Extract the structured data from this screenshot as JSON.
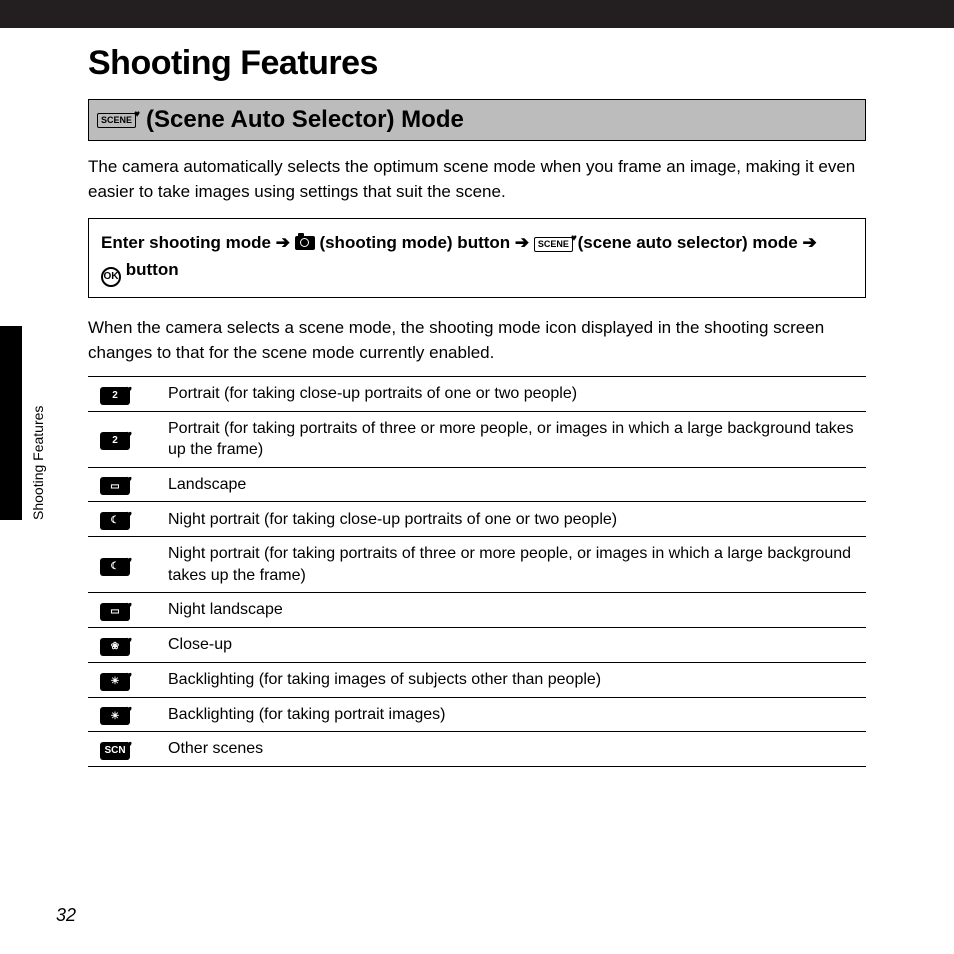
{
  "chapterTitle": "Shooting Features",
  "sideLabel": "Shooting Features",
  "pageNumber": "32",
  "sectionHeading": "(Scene Auto Selector) Mode",
  "introText": "The camera automatically selects the optimum scene mode when you frame an image, making it even easier to take images using settings that suit the scene.",
  "navigation": {
    "p1": "Enter shooting mode",
    "p2": "(shooting mode) button",
    "p3": "(scene auto selector) mode",
    "p4": "button"
  },
  "afterText": "When the camera selects a scene mode, the shooting mode icon displayed in the shooting screen changes to that for the scene mode currently enabled.",
  "rows": [
    {
      "badge": "2",
      "desc": "Portrait (for taking close-up portraits of one or two people)"
    },
    {
      "badge": "2",
      "desc": "Portrait (for taking portraits of three or more people, or images in which a large background takes up the frame)"
    },
    {
      "badge": "▭",
      "desc": "Landscape"
    },
    {
      "badge": "☾",
      "desc": "Night portrait (for taking close-up portraits of one or two people)"
    },
    {
      "badge": "☾",
      "desc": "Night portrait (for taking portraits of three or more people, or images in which a large background takes up the frame)"
    },
    {
      "badge": "▭",
      "desc": "Night landscape"
    },
    {
      "badge": "❀",
      "desc": "Close-up"
    },
    {
      "badge": "☀",
      "desc": "Backlighting (for taking images of subjects other than people)"
    },
    {
      "badge": "☀",
      "desc": "Backlighting (for taking portrait images)"
    },
    {
      "badge": "SCN",
      "desc": "Other scenes"
    }
  ]
}
